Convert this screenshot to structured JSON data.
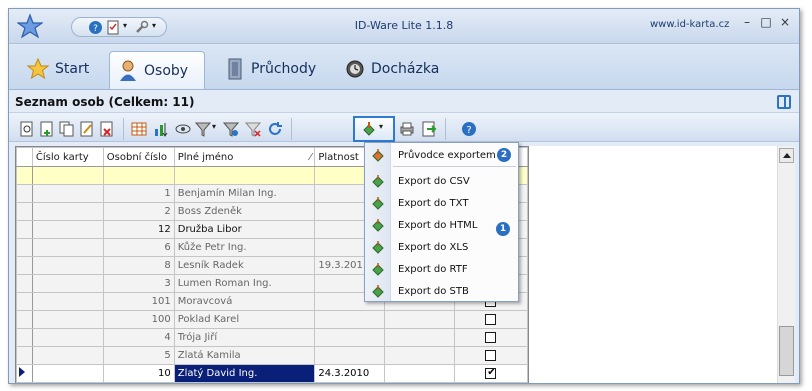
{
  "app": {
    "title": "ID-Ware Lite 1.1.8",
    "weblink": "www.id-karta.cz",
    "window_buttons": [
      "–",
      "□",
      "×"
    ]
  },
  "tabs": [
    {
      "label": "Start",
      "icon": "star-icon"
    },
    {
      "label": "Osoby",
      "icon": "person-icon",
      "active": true
    },
    {
      "label": "Průchody",
      "icon": "door-icon"
    },
    {
      "label": "Docházka",
      "icon": "clock-icon"
    }
  ],
  "list": {
    "title": "Seznam osob (Celkem: 11)"
  },
  "grid": {
    "columns": [
      "Číslo karty",
      "Osobní číslo",
      "Plné jméno",
      "Platnost"
    ],
    "rows": [
      {
        "card": "",
        "personal": "1",
        "name": "Benjamín Milan Ing.",
        "valid": "",
        "checked": false
      },
      {
        "card": "",
        "personal": "2",
        "name": "Boss Zdeněk",
        "valid": "",
        "checked": false
      },
      {
        "card": "",
        "personal": "12",
        "name": "Družba Libor",
        "valid": "",
        "checked": false
      },
      {
        "card": "",
        "personal": "6",
        "name": "Kůže Petr Ing.",
        "valid": "",
        "checked": false
      },
      {
        "card": "",
        "personal": "8",
        "name": "Lesník Radek",
        "valid": "19.3.201",
        "checked": false
      },
      {
        "card": "",
        "personal": "3",
        "name": "Lumen Roman Ing.",
        "valid": "",
        "checked": false
      },
      {
        "card": "",
        "personal": "101",
        "name": "Moravcová",
        "valid": "",
        "checked": false
      },
      {
        "card": "",
        "personal": "100",
        "name": "Poklad Karel",
        "valid": "",
        "checked": false
      },
      {
        "card": "",
        "personal": "4",
        "name": "Trója Jiří",
        "valid": "",
        "checked": false
      },
      {
        "card": "",
        "personal": "5",
        "name": "Zlatá Kamila",
        "valid": "",
        "checked": false
      },
      {
        "card": "",
        "personal": "10",
        "name": "Zlatý David Ing.",
        "valid": "24.3.2010",
        "checked": true
      }
    ]
  },
  "export_menu": {
    "items": [
      "Průvodce exportem",
      "Export do CSV",
      "Export do TXT",
      "Export do HTML",
      "Export do XLS",
      "Export do RTF",
      "Export do STB"
    ],
    "badge_1": "1",
    "badge_2": "2"
  }
}
